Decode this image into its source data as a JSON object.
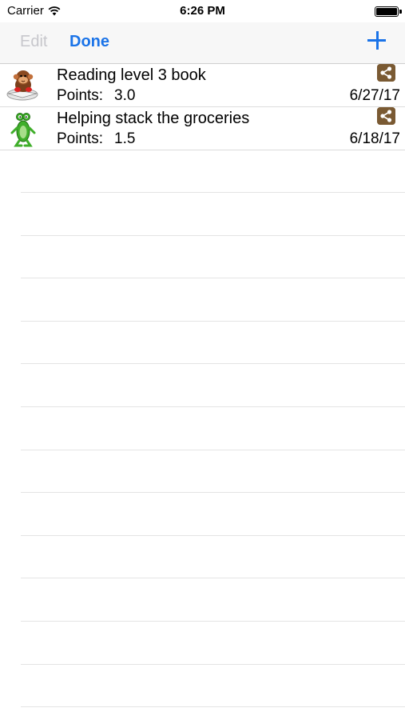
{
  "status_bar": {
    "carrier": "Carrier",
    "time": "6:26 PM",
    "icons": [
      "wifi-icon",
      "battery-icon"
    ]
  },
  "nav": {
    "edit_label": "Edit",
    "done_label": "Done",
    "add_icon": "plus-icon",
    "accent_color": "#1a73e8",
    "disabled_color": "#c7c7cc"
  },
  "items": [
    {
      "title": "Reading level 3 book",
      "points_label": "Points:",
      "points_value": "3.0",
      "date": "6/27/17",
      "icon": "monkey-reading-icon",
      "share_icon": "share-icon"
    },
    {
      "title": "Helping stack the groceries",
      "points_label": "Points:",
      "points_value": "1.5",
      "date": "6/18/17",
      "icon": "green-frog-icon",
      "share_icon": "share-icon"
    }
  ],
  "share_color": "#7a5a33"
}
